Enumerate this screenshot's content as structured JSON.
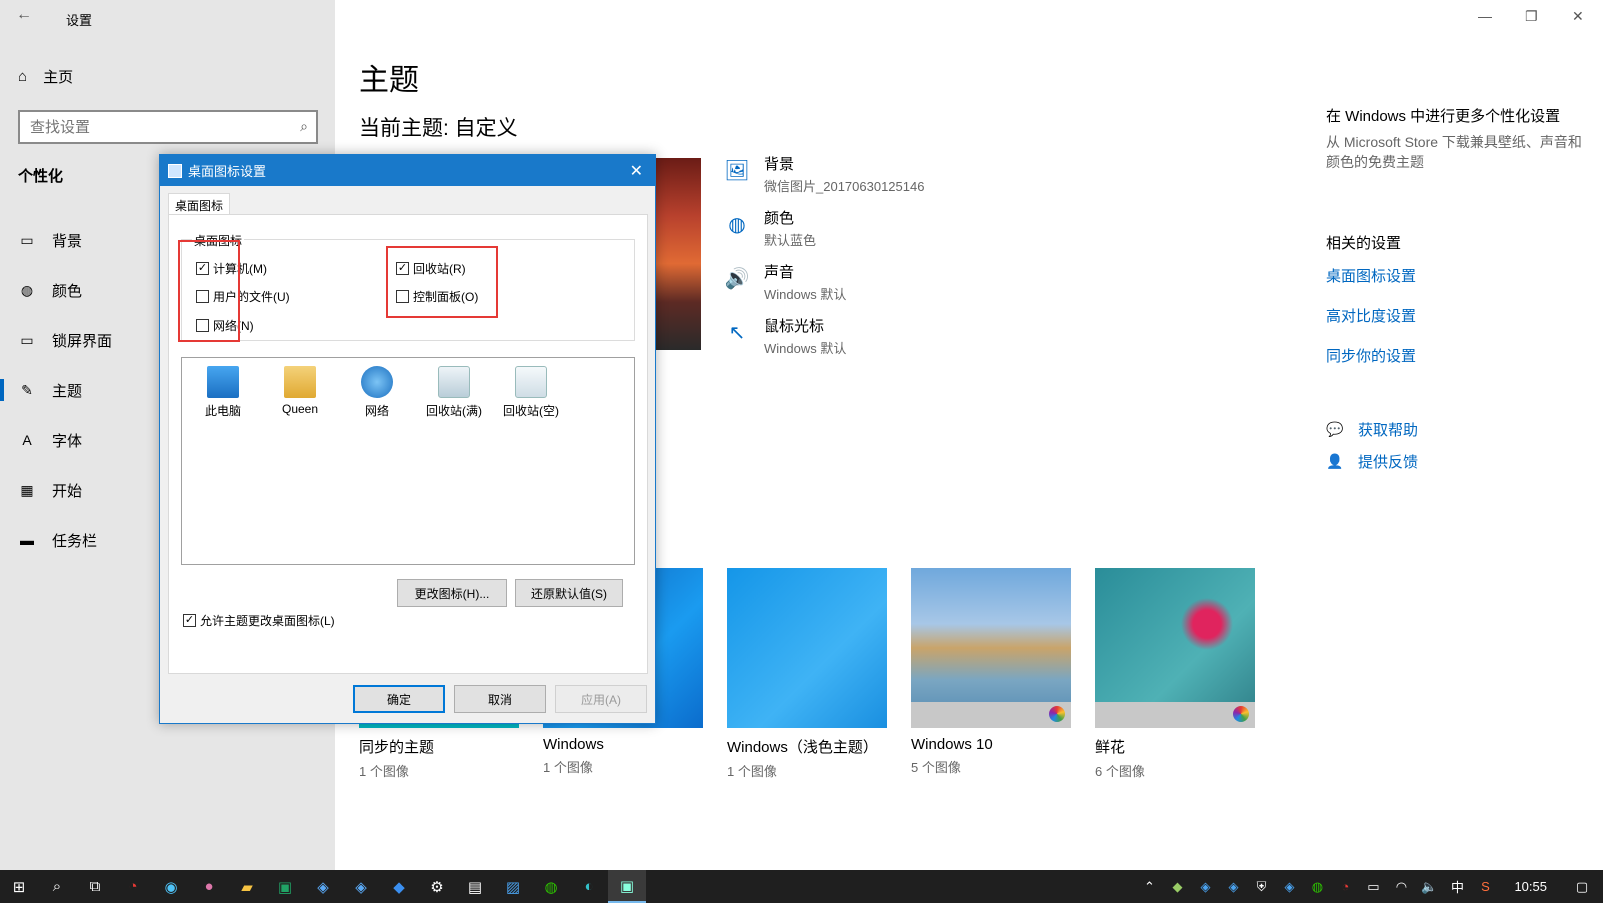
{
  "window": {
    "title": "设置",
    "back": "←",
    "minimize": "—",
    "restore": "❐",
    "close": "✕"
  },
  "sidebar": {
    "home": "主页",
    "search_placeholder": "查找设置",
    "section": "个性化",
    "items": [
      {
        "label": "背景",
        "icon": "image-icon"
      },
      {
        "label": "颜色",
        "icon": "palette-icon"
      },
      {
        "label": "锁屏界面",
        "icon": "lockscreen-icon"
      },
      {
        "label": "主题",
        "icon": "theme-icon"
      },
      {
        "label": "字体",
        "icon": "font-icon"
      },
      {
        "label": "开始",
        "icon": "start-icon"
      },
      {
        "label": "任务栏",
        "icon": "taskbar-icon"
      }
    ]
  },
  "main": {
    "title": "主题",
    "current_theme": "当前主题: 自定义",
    "properties": [
      {
        "label": "背景",
        "value": "微信图片_20170630125146"
      },
      {
        "label": "颜色",
        "value": "默认蓝色"
      },
      {
        "label": "声音",
        "value": "Windows 默认"
      },
      {
        "label": "鼠标光标",
        "value": "Windows 默认"
      }
    ],
    "themes": [
      {
        "name": "同步的主题",
        "count": "1 个图像"
      },
      {
        "name": "Windows",
        "count": "1 个图像"
      },
      {
        "name": "Windows（浅色主题）",
        "count": "1 个图像"
      },
      {
        "name": "Windows 10",
        "count": "5 个图像"
      },
      {
        "name": "鲜花",
        "count": "6 个图像"
      }
    ]
  },
  "right": {
    "store_title": "在 Windows 中进行更多个性化设置",
    "store_desc": "从 Microsoft Store 下载兼具壁纸、声音和颜色的免费主题",
    "related_title": "相关的设置",
    "links": [
      "桌面图标设置",
      "高对比度设置",
      "同步你的设置"
    ],
    "help": "获取帮助",
    "feedback": "提供反馈"
  },
  "dialog": {
    "title": "桌面图标设置",
    "tab": "桌面图标",
    "group": "桌面图标",
    "checkboxes": {
      "computer": {
        "label": "计算机(M)",
        "checked": true
      },
      "user_files": {
        "label": "用户的文件(U)",
        "checked": false
      },
      "network": {
        "label": "网络(N)",
        "checked": false
      },
      "recycle_bin": {
        "label": "回收站(R)",
        "checked": true
      },
      "control_panel": {
        "label": "控制面板(O)",
        "checked": false
      }
    },
    "icons": [
      "此电脑",
      "Queen",
      "网络",
      "回收站(满)",
      "回收站(空)"
    ],
    "change_icon": "更改图标(H)...",
    "restore_default": "还原默认值(S)",
    "allow_themes": {
      "label": "允许主题更改桌面图标(L)",
      "checked": true
    },
    "ok": "确定",
    "cancel": "取消",
    "apply": "应用(A)",
    "check_mark": "✓"
  },
  "taskbar": {
    "time": "10:55",
    "ime": "中"
  },
  "colors": {
    "accent": "#0067c0",
    "dialog_title": "#1979ca",
    "highlight": "#e53935"
  }
}
